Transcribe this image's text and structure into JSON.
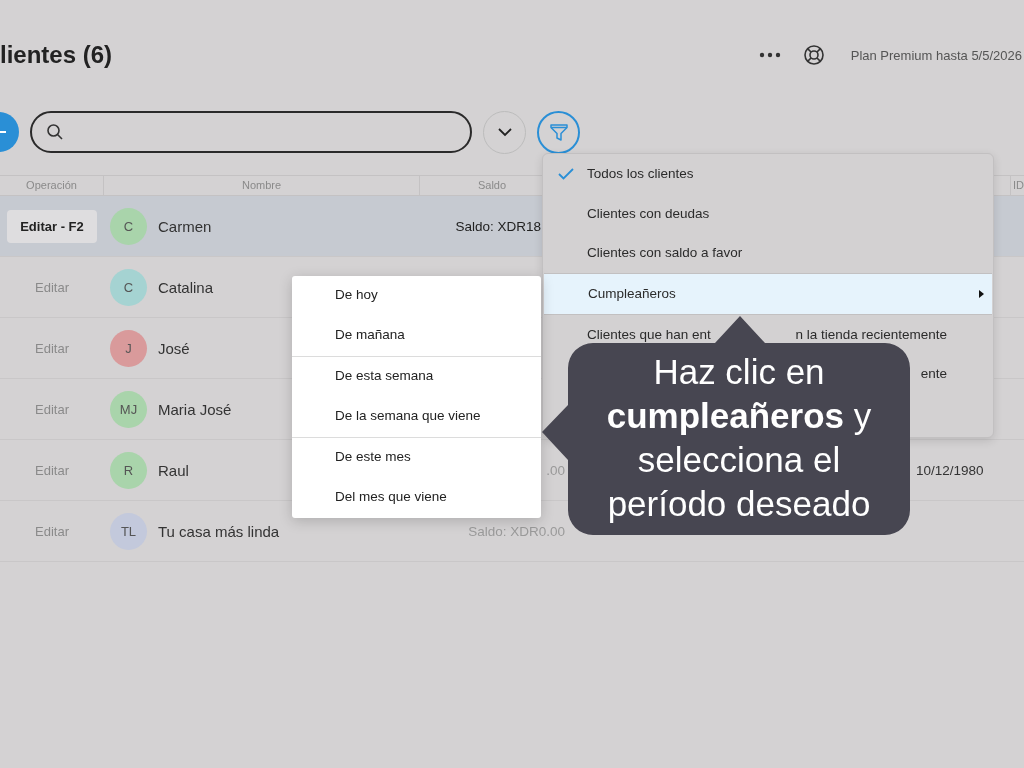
{
  "header": {
    "title": "lientes (6)",
    "plan": "Plan Premium hasta 5/5/2026"
  },
  "table": {
    "columns": [
      "Operación",
      "Nombre",
      "Saldo"
    ],
    "last_column": "ID",
    "rows": [
      {
        "action": "Editar - F2",
        "selected": true,
        "initials": "C",
        "color": "#a9d4ab",
        "name": "Carmen",
        "balance": "Saldo: XDR18",
        "date": ""
      },
      {
        "action": "Editar",
        "selected": false,
        "initials": "C",
        "color": "#a5d3d2",
        "name": "Catalina",
        "balance": "",
        "date": ""
      },
      {
        "action": "Editar",
        "selected": false,
        "initials": "J",
        "color": "#d99a9b",
        "name": "José",
        "balance": "",
        "date": ""
      },
      {
        "action": "Editar",
        "selected": false,
        "initials": "MJ",
        "color": "#a9d4ab",
        "name": "Maria José",
        "balance": "",
        "date": ""
      },
      {
        "action": "Editar",
        "selected": false,
        "initials": "R",
        "color": "#a9d4ab",
        "name": "Raul",
        "balance": ".00",
        "date": "10/12/1980"
      },
      {
        "action": "Editar",
        "selected": false,
        "initials": "TL",
        "color": "#c3c9dc",
        "name": "Tu casa más linda",
        "balance": "Saldo: XDR0.00",
        "date": ""
      }
    ]
  },
  "filter_menu": {
    "items": [
      {
        "kind": "text",
        "parts": [
          "Todos los clientes"
        ],
        "checked": true,
        "selected": false,
        "has_submenu": false
      },
      {
        "kind": "text",
        "parts": [
          "Clientes con deudas"
        ],
        "checked": false,
        "selected": false,
        "has_submenu": false
      },
      {
        "kind": "text",
        "parts": [
          "Clientes con saldo a favor"
        ],
        "checked": false,
        "selected": false,
        "has_submenu": false
      },
      {
        "kind": "text",
        "parts": [
          "Cumpleañeros"
        ],
        "checked": false,
        "selected": true,
        "has_submenu": true
      },
      {
        "kind": "cut",
        "parts": [
          "Clientes que han ent",
          "n la tienda recientemente"
        ],
        "checked": false,
        "selected": false,
        "has_submenu": false
      },
      {
        "kind": "cut",
        "parts": [
          "ente"
        ],
        "checked": false,
        "selected": false,
        "has_submenu": false
      }
    ]
  },
  "submenu": {
    "groups": [
      [
        "De hoy",
        "De mañana"
      ],
      [
        "De esta semana",
        "De la semana que viene"
      ],
      [
        "De este mes",
        "Del mes que viene"
      ]
    ]
  },
  "callout": {
    "lines": [
      "Haz clic en",
      "**cumpleañeros** y",
      "selecciona el",
      "período deseado"
    ]
  }
}
